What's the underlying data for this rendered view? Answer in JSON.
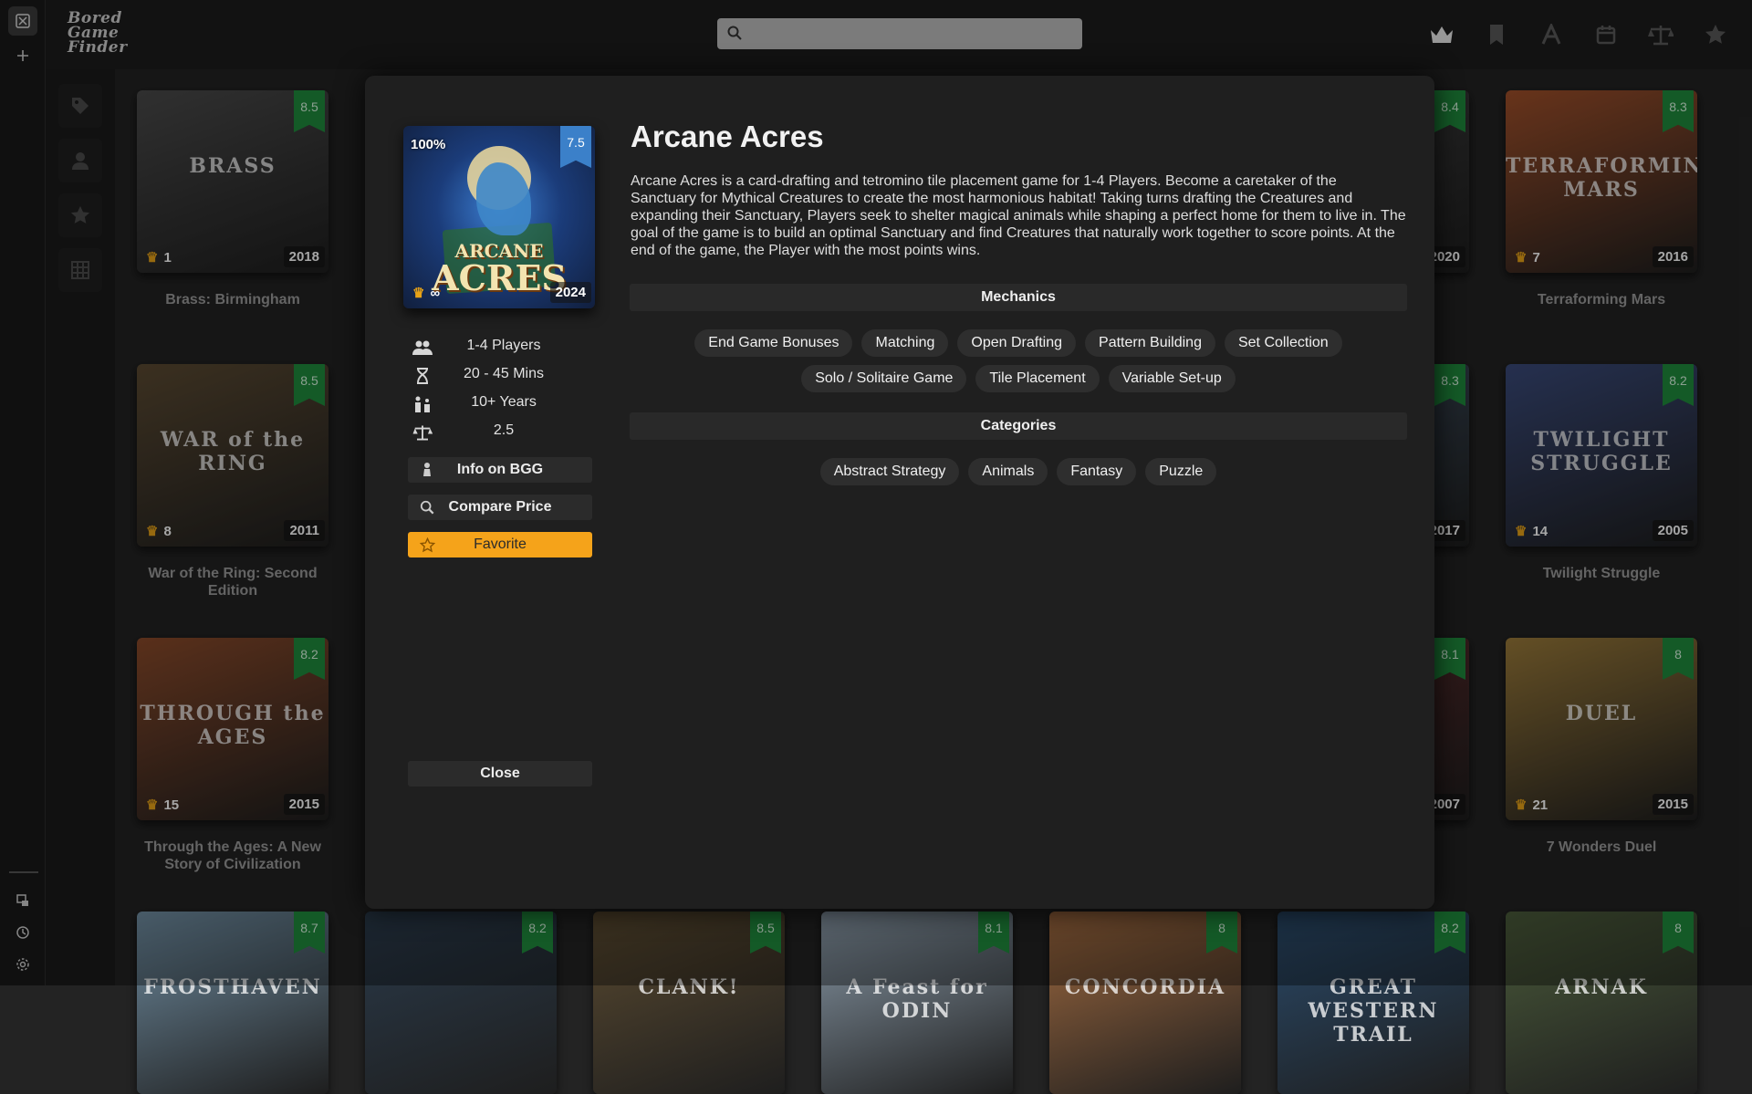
{
  "app": {
    "logo_lines": [
      "Bored",
      "Game",
      "Finder"
    ]
  },
  "search": {
    "placeholder": ""
  },
  "grid": {
    "cards": [
      {
        "name": "Brass: Birmingham",
        "cover_text": "BRASS",
        "rating": "8.5",
        "rank": "1",
        "year": "2018",
        "color": "#4a4a4a"
      },
      {
        "name": "War of the Ring: Second Edition",
        "cover_text": "WAR of the RING",
        "rating": "8.5",
        "rank": "8",
        "year": "2011",
        "color": "#5b4a32"
      },
      {
        "name": "Through the Ages: A New Story of Civilization",
        "cover_text": "THROUGH the AGES",
        "rating": "8.2",
        "rank": "15",
        "year": "2015",
        "color": "#8a4a2a"
      },
      {
        "name": "",
        "cover_text": "FROSTHAVEN",
        "rating": "8.7",
        "rank": "",
        "year": "",
        "color": "#6f8ca0"
      },
      {
        "name": "",
        "cover_text": "",
        "rating": "8.2",
        "rank": "",
        "year": "",
        "color": "#2a3a4a"
      },
      {
        "name": "",
        "cover_text": "CLANK!",
        "rating": "8.5",
        "rank": "",
        "year": "",
        "color": "#5a4a30"
      },
      {
        "name": "",
        "cover_text": "A Feast for ODIN",
        "rating": "8.1",
        "rank": "",
        "year": "",
        "color": "#8a9aa8"
      },
      {
        "name": "",
        "cover_text": "CONCORDIA",
        "rating": "8",
        "rank": "",
        "year": "",
        "color": "#a06a40"
      },
      {
        "name": "",
        "cover_text": "GREAT WESTERN TRAIL",
        "rating": "8.2",
        "rank": "",
        "year": "",
        "color": "#2a4a6a"
      },
      {
        "name": "",
        "cover_text": "ARNAK",
        "rating": "8",
        "rank": "",
        "year": "",
        "color": "#4a5a3a"
      },
      {
        "name": "",
        "cover_text": "",
        "rating": "8.4",
        "rank": "",
        "year": "2020",
        "color": "#3a3a3a"
      },
      {
        "name": "",
        "cover_text": "",
        "rating": "8.3",
        "rank": "",
        "year": "2017",
        "color": "#3a4a5a"
      },
      {
        "name": "",
        "cover_text": "",
        "rating": "8.1",
        "rank": "",
        "year": "2007",
        "color": "#5a2a2a"
      },
      {
        "name": "Terraforming Mars",
        "cover_text": "TERRAFORMING MARS",
        "rating": "8.3",
        "rank": "7",
        "year": "2016",
        "color": "#a0502a"
      },
      {
        "name": "Twilight Struggle",
        "cover_text": "TWILIGHT STRUGGLE",
        "rating": "8.2",
        "rank": "14",
        "year": "2005",
        "color": "#3a4a7a"
      },
      {
        "name": "7 Wonders Duel",
        "cover_text": "DUEL",
        "rating": "8",
        "rank": "21",
        "year": "2015",
        "color": "#9a7a3a"
      }
    ]
  },
  "modal": {
    "title": "Arcane Acres",
    "description": "Arcane Acres is a card-drafting and tetromino tile placement game for 1-4 Players. Become a caretaker of the Sanctuary for Mythical Creatures to create the most harmonious habitat! Taking turns drafting the Creatures and expanding their Sanctuary, Players seek to shelter magical animals while shaping a perfect home for them to live in. The goal of the game is to build an optimal Sanctuary and find Creatures that naturally work together to score points. At the end of the game, the Player with the most points wins.",
    "cover": {
      "title_line1": "ARCANE",
      "title_line2": "ACRES",
      "match_percent": "100%",
      "rating": "7.5",
      "rank": "∞",
      "year": "2024"
    },
    "stats": {
      "players": "1-4 Players",
      "time": "20 - 45 Mins",
      "age": "10+ Years",
      "weight": "2.5"
    },
    "buttons": {
      "bgg": "Info on BGG",
      "compare": "Compare Price",
      "favorite": "Favorite",
      "close": "Close"
    },
    "mechanics_label": "Mechanics",
    "mechanics_row1": [
      "End Game Bonuses",
      "Matching",
      "Open Drafting",
      "Pattern Building",
      "Set Collection"
    ],
    "mechanics_row2": [
      "Solo / Solitaire Game",
      "Tile Placement",
      "Variable Set-up"
    ],
    "categories_label": "Categories",
    "categories": [
      "Abstract Strategy",
      "Animals",
      "Fantasy",
      "Puzzle"
    ]
  },
  "colors": {
    "accent_favorite": "#f5a31a",
    "rating_ribbon": "#1f8a3c",
    "modal_rating_ribbon": "#3b80c9",
    "crown": "#e8a317"
  }
}
